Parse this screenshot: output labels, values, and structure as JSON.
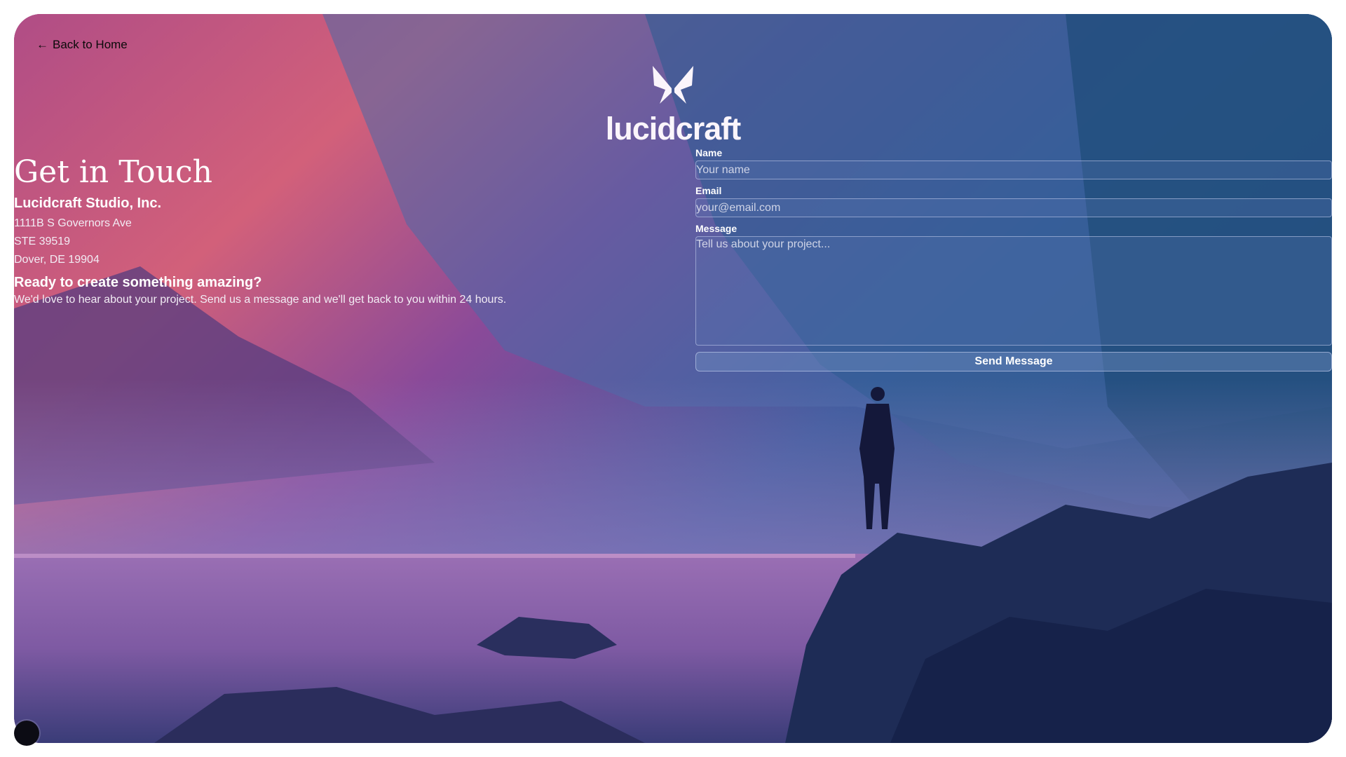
{
  "nav": {
    "back_label": "Back to Home",
    "back_icon": "arrow-left-icon"
  },
  "brand": {
    "name": "lucidcraft",
    "logo_icon": "butterfly-icon"
  },
  "contact": {
    "title": "Get in Touch",
    "company": "Lucidcraft Studio, Inc.",
    "address_lines": [
      "1111B S Governors Ave",
      "STE 39519",
      "Dover, DE 19904"
    ],
    "tagline": "Ready to create something amazing?",
    "description": "We'd love to hear about your project. Send us a message and we'll get back to you within 24 hours."
  },
  "form": {
    "name_label": "Name",
    "name_placeholder": "Your name",
    "email_label": "Email",
    "email_placeholder": "your@email.com",
    "message_label": "Message",
    "message_placeholder": "Tell us about your project...",
    "submit_label": "Send Message"
  },
  "colors": {
    "accent": "#ffffff",
    "frame_top": "#c4527a",
    "frame_bottom": "#1a3355"
  }
}
